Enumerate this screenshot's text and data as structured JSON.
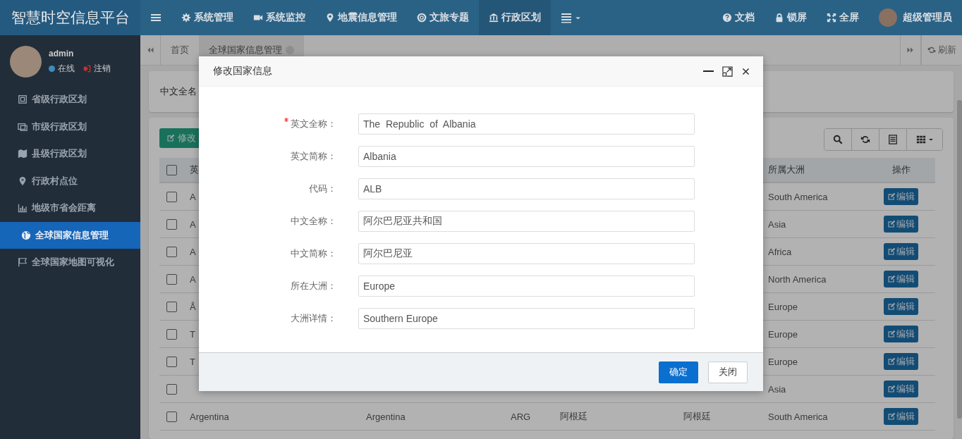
{
  "header": {
    "logo": "智慧时空信息平台",
    "nav": [
      {
        "label": "系统管理",
        "selected": false
      },
      {
        "label": "系统监控",
        "selected": false
      },
      {
        "label": "地震信息管理",
        "selected": false
      },
      {
        "label": "文旅专题",
        "selected": false
      },
      {
        "label": "行政区划",
        "selected": true
      }
    ],
    "right": [
      {
        "label": "文档"
      },
      {
        "label": "锁屏"
      },
      {
        "label": "全屏"
      }
    ],
    "user": "超级管理员"
  },
  "sidebar": {
    "user": {
      "name": "admin",
      "status": "在线",
      "logout": "注销"
    },
    "items": [
      {
        "label": "省级行政区划",
        "selected": false
      },
      {
        "label": "市级行政区划",
        "selected": false
      },
      {
        "label": "县级行政区划",
        "selected": false
      },
      {
        "label": "行政村点位",
        "selected": false
      },
      {
        "label": "地级市省会距离",
        "selected": false
      },
      {
        "label": "全球国家信息管理",
        "selected": true
      },
      {
        "label": "全球国家地图可视化",
        "selected": false
      }
    ]
  },
  "tabs": [
    {
      "label": "首页",
      "closable": false,
      "selected": false
    },
    {
      "label": "全球国家信息管理",
      "closable": true,
      "selected": true
    }
  ],
  "refresh": "刷新",
  "search": {
    "label": "中文全名"
  },
  "toolbar": {
    "edit": "修改"
  },
  "table": {
    "header": {
      "checked": false,
      "column_1": "英",
      "column_6": "所属大洲",
      "column_7": "操作"
    },
    "rows": [
      {
        "checked": false,
        "column_1": "A",
        "column_6": "South America",
        "action": "编辑"
      },
      {
        "checked": false,
        "column_1": "A",
        "column_6": "Asia",
        "action": "编辑"
      },
      {
        "checked": false,
        "column_1": "A",
        "column_6": "Africa",
        "action": "编辑"
      },
      {
        "checked": false,
        "column_1": "A",
        "column_6": "North America",
        "action": "编辑"
      },
      {
        "checked": false,
        "column_1": "Å",
        "column_6": "Europe",
        "action": "编辑"
      },
      {
        "checked": false,
        "column_1": "T",
        "column_6": "Europe",
        "action": "编辑"
      },
      {
        "checked": false,
        "column_1": "T",
        "column_6": "Europe",
        "action": "编辑"
      },
      {
        "checked": false,
        "column_6": "Asia",
        "action": "编辑"
      },
      {
        "checked": false,
        "column_1": "Argentina",
        "column_2": "Argentina",
        "column_3": "ARG",
        "column_4": "阿根廷",
        "column_5": "阿根廷",
        "column_6": "South America",
        "action": "编辑"
      }
    ]
  },
  "dialog": {
    "title": "修改国家信息",
    "fields": [
      {
        "label": "英文全称：",
        "value": "The  Republic  of  Albania",
        "required": true
      },
      {
        "label": "英文简称：",
        "value": "Albania",
        "required": false
      },
      {
        "label": "代码：",
        "value": "ALB",
        "required": false
      },
      {
        "label": "中文全称：",
        "value": "阿尔巴尼亚共和国",
        "required": false
      },
      {
        "label": "中文简称：",
        "value": "阿尔巴尼亚",
        "required": false
      },
      {
        "label": "所在大洲：",
        "value": "Europe",
        "required": false
      },
      {
        "label": "大洲详情：",
        "value": "Southern Europe",
        "required": false
      }
    ],
    "ok": "确定",
    "cancel": "关闭"
  }
}
